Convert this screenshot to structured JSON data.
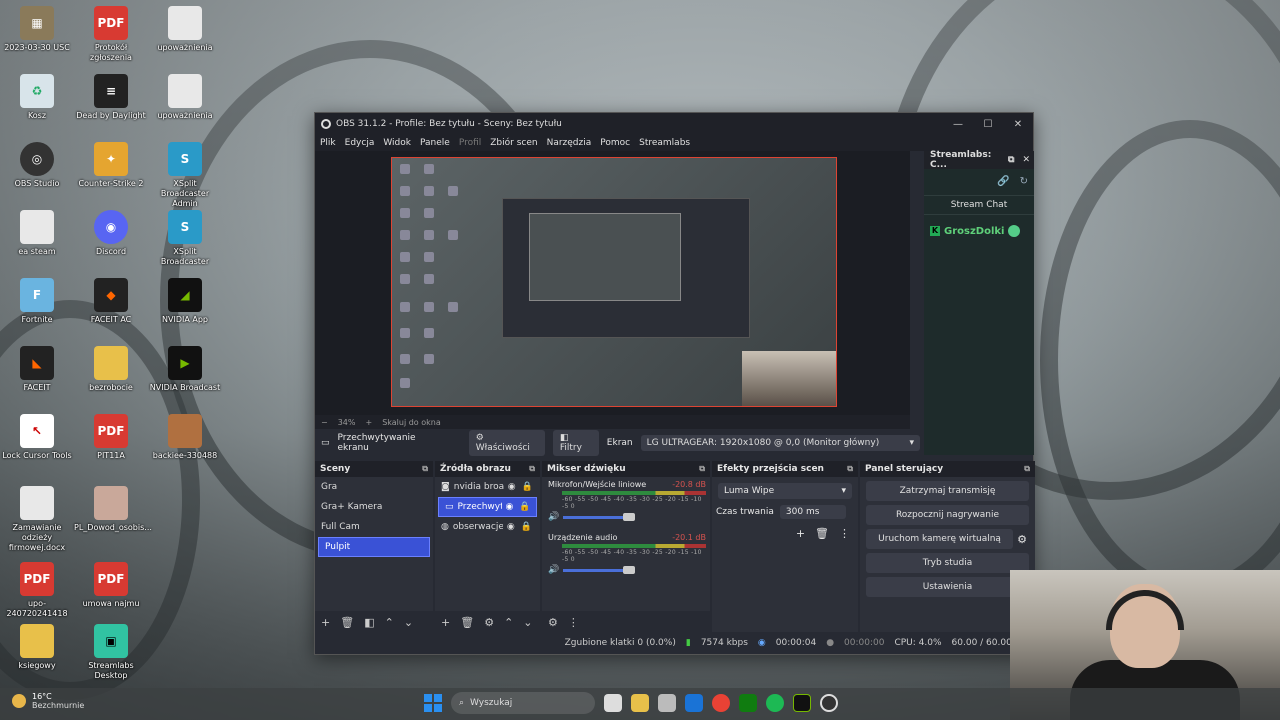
{
  "desktop": {
    "icons": [
      {
        "label": "2023-03-30 USC"
      },
      {
        "label": "Protokół zgłoszenia"
      },
      {
        "label": "upoważnienia"
      },
      {
        "label": "Kosz"
      },
      {
        "label": "Dead by Daylight"
      },
      {
        "label": "upoważnienia"
      },
      {
        "label": "OBS Studio"
      },
      {
        "label": "Counter-Strike 2"
      },
      {
        "label": "XSplit Broadcaster Admin"
      },
      {
        "label": "ea steam"
      },
      {
        "label": "Discord"
      },
      {
        "label": "XSplit Broadcaster"
      },
      {
        "label": "Fortnite"
      },
      {
        "label": "FACEIT AC"
      },
      {
        "label": "NVIDIA App"
      },
      {
        "label": "FACEIT"
      },
      {
        "label": "bezrobocie"
      },
      {
        "label": "NVIDIA Broadcast"
      },
      {
        "label": "Lock Cursor Tools"
      },
      {
        "label": "PIT11A"
      },
      {
        "label": "backiee-330488"
      },
      {
        "label": "Zamawianie odzieży firmowej.docx"
      },
      {
        "label": "PL_Dowod_osobis..."
      },
      {
        "label": "upo-240720241418"
      },
      {
        "label": "umowa najmu"
      },
      {
        "label": "ksiegowy"
      },
      {
        "label": "Streamlabs Desktop"
      }
    ]
  },
  "obs": {
    "title": "OBS 31.1.2 - Profile: Bez tytułu - Sceny: Bez tytułu",
    "menu": [
      "Plik",
      "Edycja",
      "Widok",
      "Panele",
      "Profil",
      "Zbiór scen",
      "Narzędzia",
      "Pomoc",
      "Streamlabs"
    ],
    "zoom": {
      "percent": "34%",
      "fit": "Skaluj do okna"
    },
    "source_bar": {
      "source_name": "Przechwytywanie ekranu",
      "properties": "Właściwości",
      "filters": "Filtry",
      "screen_label": "Ekran",
      "screen_value": "LG ULTRAGEAR: 1920x1080 @ 0,0 (Monitor główny)"
    },
    "chat": {
      "title": "Streamlabs: C...",
      "section": "Stream Chat",
      "user": "GroszDolki"
    },
    "scenes": {
      "title": "Sceny",
      "items": [
        "Gra",
        "Gra+ Kamera",
        "Full Cam",
        "Pulpit"
      ],
      "active_index": 3
    },
    "sources": {
      "title": "Źródła obrazu",
      "items": [
        "nvidia broa",
        "Przechwyt",
        "obserwacje"
      ]
    },
    "mixer": {
      "title": "Mikser dźwięku",
      "scale": "-60 -55 -50 -45 -40 -35 -30 -25 -20 -15 -10 -5 0",
      "channels": [
        {
          "name": "Mikrofon/Wejście liniowe",
          "db": "-20.8 dB"
        },
        {
          "name": "Urządzenie audio",
          "db": "-20.1 dB"
        }
      ]
    },
    "transitions": {
      "title": "Efekty przejścia scen",
      "selected": "Luma Wipe",
      "duration_label": "Czas trwania",
      "duration_value": "300 ms"
    },
    "controls": {
      "title": "Panel sterujący",
      "stop_stream": "Zatrzymaj transmisję",
      "start_recording": "Rozpocznij nagrywanie",
      "virtual_cam": "Uruchom kamerę wirtualną",
      "studio_mode": "Tryb studia",
      "settings": "Ustawienia"
    },
    "status": {
      "dropped": "Zgubione klatki 0 (0.0%)",
      "bitrate": "7574 kbps",
      "stream_time": "00:00:04",
      "rec_time": "00:00:00",
      "cpu": "CPU: 4.0%",
      "fps": "60.00 / 60.00 FPS"
    }
  },
  "taskbar": {
    "temp": "16°C",
    "weather": "Bezchmurnie",
    "search_placeholder": "Wyszukaj"
  },
  "colors": {
    "accent": "#3a52d6",
    "preview_border": "#dd4433",
    "chat_user": "#5fd07a"
  }
}
